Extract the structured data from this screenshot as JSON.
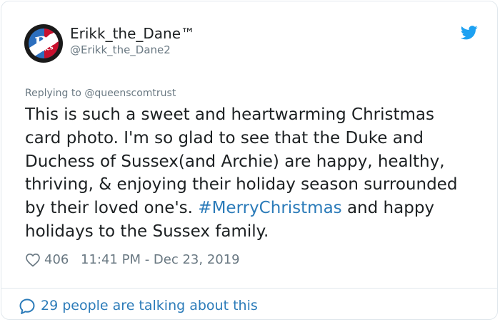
{
  "author": {
    "display_name": "Erikk_the_Dane™",
    "handle": "@Erikk_the_Dane2",
    "avatar_icon": "dc-logo-avatar"
  },
  "reply": {
    "text": "Replying to @queenscomtrust"
  },
  "tweet": {
    "line1": "This is such a sweet and heartwarming Christmas",
    "line2": "card photo. I'm so glad to see that the Duke and",
    "line3": "Duchess of Sussex(and Archie) are happy, healthy,",
    "line4": "thriving, & enjoying their holiday season surrounded",
    "line5_before": "by their loved one's. ",
    "line5_hashtag": "#MerryChristmas",
    "line5_after": " and happy",
    "line6": "holidays to the Sussex family."
  },
  "meta": {
    "likes": "406",
    "timestamp": "11:41 PM - Dec 23, 2019"
  },
  "footer": {
    "talking_label": "29 people are talking about this"
  },
  "icons": {
    "brand": "twitter-bird-icon",
    "like": "heart-icon",
    "conversation": "speech-bubble-icon"
  },
  "colors": {
    "link": "#2b7bb9",
    "twitter_blue": "#1da1f2",
    "secondary_text": "#697882",
    "primary_text": "#1c2022",
    "border": "#e1e8ed"
  }
}
